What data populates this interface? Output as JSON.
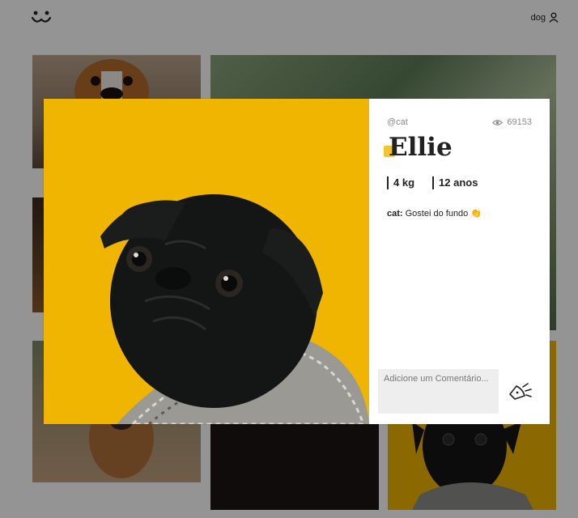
{
  "header": {
    "user_name": "dog"
  },
  "photo": {
    "author": "@cat",
    "views": "69153",
    "name": "Ellie",
    "weight": "4 kg",
    "age": "12 anos"
  },
  "comments": [
    {
      "user": "cat:",
      "text": "Gostei do fundo 👏"
    }
  ],
  "comment_form": {
    "placeholder": "Adicione um Comentário..."
  },
  "colors": {
    "accent": "#f0b500",
    "overlay": "rgba(0,0,0,0.42)"
  },
  "icons": [
    "logo-icon",
    "user-icon",
    "eye-icon",
    "send-icon"
  ]
}
